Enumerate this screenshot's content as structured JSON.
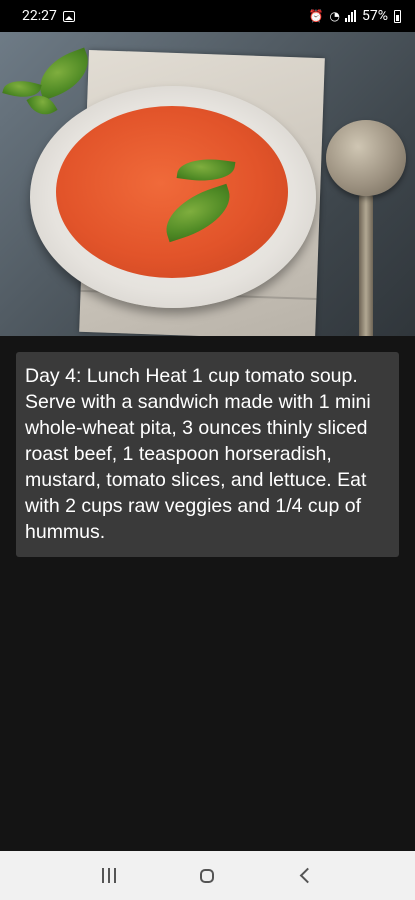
{
  "status_bar": {
    "time": "22:27",
    "battery": "57%",
    "icons": [
      "image-icon",
      "alarm-icon",
      "wifi-icon",
      "signal-icon",
      "battery-icon"
    ]
  },
  "hero": {
    "image": "tomato-soup-photo"
  },
  "card": {
    "text": "Day 4: Lunch Heat 1 cup tomato soup. Serve with a sandwich made with 1 mini whole-wheat pita, 3 ounces thinly sliced roast beef, 1 teaspoon horseradish, mustard, tomato slices, and lettuce. Eat with 2 cups raw veggies and 1/4 cup of hummus."
  },
  "nav_bar": {
    "icons": [
      "recents-icon",
      "home-icon",
      "back-icon"
    ]
  },
  "colors": {
    "background": "#141414",
    "card": "#3a3a3a",
    "nav_bar": "#f1f1f1",
    "status_bar": "#000000"
  }
}
